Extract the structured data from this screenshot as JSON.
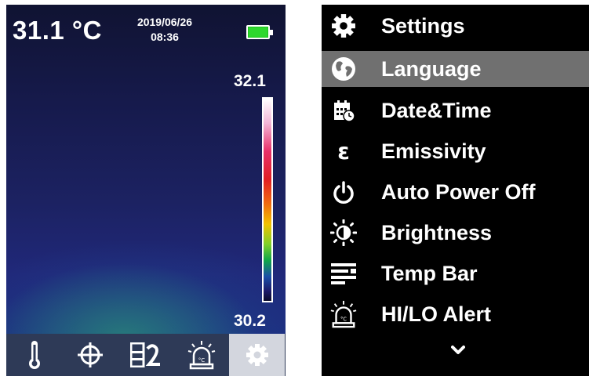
{
  "camera": {
    "temperature": "31.1 °C",
    "date": "2019/06/26",
    "time": "08:36",
    "scale_max": "32.1",
    "scale_min": "30.2",
    "battery_level": 1.0,
    "colors": {
      "toolbar_bg": "#2e3a57",
      "active_tool_bg": "#d3d6de",
      "battery": "#2ed82e"
    },
    "toolbar": [
      {
        "icon": "thermometer-icon",
        "active": false
      },
      {
        "icon": "crosshair-icon",
        "active": false
      },
      {
        "icon": "palette-icon",
        "active": false
      },
      {
        "icon": "alarm-icon",
        "active": false
      },
      {
        "icon": "gear-icon",
        "active": true
      }
    ]
  },
  "settings": {
    "title": "Settings",
    "title_icon": "gear-icon",
    "selected_index": 0,
    "selected_bg": "#707070",
    "items": [
      {
        "label": "Language",
        "icon": "globe-icon"
      },
      {
        "label": "Date&Time",
        "icon": "calendar-icon"
      },
      {
        "label": "Emissivity",
        "icon": "epsilon-icon"
      },
      {
        "label": "Auto Power Off",
        "icon": "power-icon"
      },
      {
        "label": "Brightness",
        "icon": "brightness-icon"
      },
      {
        "label": "Temp Bar",
        "icon": "temp-bar-icon"
      },
      {
        "label": "HI/LO Alert",
        "icon": "alarm-icon"
      }
    ],
    "more_icon": "chevron-down-icon"
  }
}
